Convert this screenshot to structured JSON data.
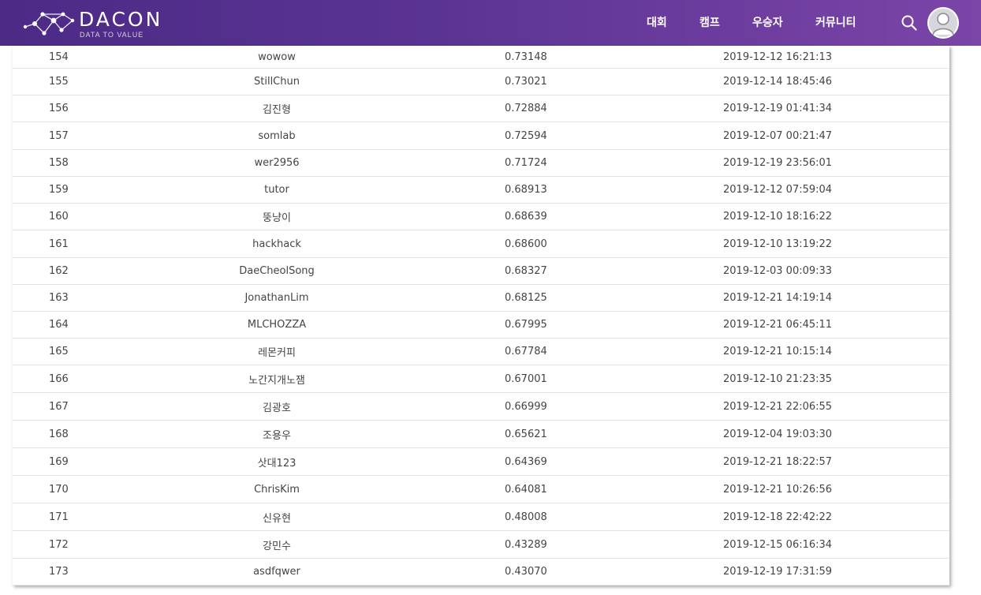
{
  "header": {
    "logo_text": "DACON",
    "logo_tagline": "DATA TO VALUE",
    "nav": [
      "대회",
      "캠프",
      "우승자",
      "커뮤니티"
    ]
  },
  "leaderboard": {
    "rows": [
      {
        "rank": "154",
        "name": "wowow",
        "score": "0.73148",
        "time": "2019-12-12 16:21:13"
      },
      {
        "rank": "155",
        "name": "StillChun",
        "score": "0.73021",
        "time": "2019-12-14 18:45:46"
      },
      {
        "rank": "156",
        "name": "김진형",
        "score": "0.72884",
        "time": "2019-12-19 01:41:34"
      },
      {
        "rank": "157",
        "name": "somlab",
        "score": "0.72594",
        "time": "2019-12-07 00:21:47"
      },
      {
        "rank": "158",
        "name": "wer2956",
        "score": "0.71724",
        "time": "2019-12-19 23:56:01"
      },
      {
        "rank": "159",
        "name": "tutor",
        "score": "0.68913",
        "time": "2019-12-12 07:59:04"
      },
      {
        "rank": "160",
        "name": "뚱냥이",
        "score": "0.68639",
        "time": "2019-12-10 18:16:22"
      },
      {
        "rank": "161",
        "name": "hackhack",
        "score": "0.68600",
        "time": "2019-12-10 13:19:22"
      },
      {
        "rank": "162",
        "name": "DaeCheolSong",
        "score": "0.68327",
        "time": "2019-12-03 00:09:33"
      },
      {
        "rank": "163",
        "name": "JonathanLim",
        "score": "0.68125",
        "time": "2019-12-21 14:19:14"
      },
      {
        "rank": "164",
        "name": "MLCHOZZA",
        "score": "0.67995",
        "time": "2019-12-21 06:45:11"
      },
      {
        "rank": "165",
        "name": "레몬커피",
        "score": "0.67784",
        "time": "2019-12-21 10:15:14"
      },
      {
        "rank": "166",
        "name": "노간지개노잼",
        "score": "0.67001",
        "time": "2019-12-10 21:23:35"
      },
      {
        "rank": "167",
        "name": "김광호",
        "score": "0.66999",
        "time": "2019-12-21 22:06:55"
      },
      {
        "rank": "168",
        "name": "조용우",
        "score": "0.65621",
        "time": "2019-12-04 19:03:30"
      },
      {
        "rank": "169",
        "name": "삿대123",
        "score": "0.64369",
        "time": "2019-12-21 18:22:57"
      },
      {
        "rank": "170",
        "name": "ChrisKim",
        "score": "0.64081",
        "time": "2019-12-21 10:26:56"
      },
      {
        "rank": "171",
        "name": "신유현",
        "score": "0.48008",
        "time": "2019-12-18 22:42:22"
      },
      {
        "rank": "172",
        "name": "강민수",
        "score": "0.43289",
        "time": "2019-12-15 06:16:34"
      },
      {
        "rank": "173",
        "name": "asdfqwer",
        "score": "0.43070",
        "time": "2019-12-19 17:31:59"
      }
    ]
  }
}
